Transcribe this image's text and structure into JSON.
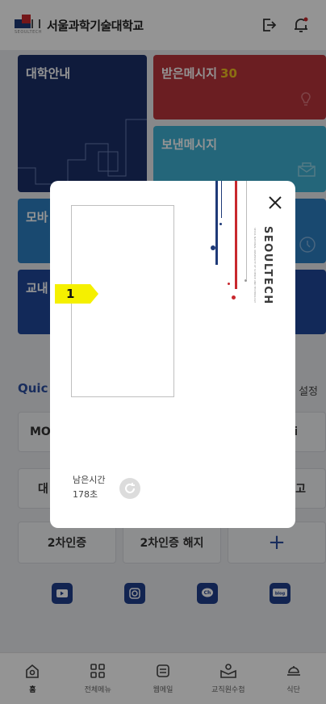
{
  "header": {
    "logo_sub": "SEOULTECH",
    "title": "서울과학기술대학교",
    "logout_icon": "logout-icon",
    "alarm_icon": "bell-settings-icon"
  },
  "tiles": {
    "university_info": "대학안내",
    "received_messages": "받은메시지",
    "received_count": "30",
    "sent_messages": "보낸메시지",
    "mobile_partial": "모바",
    "staff_partial": "교내"
  },
  "quick": {
    "title_partial": "Quic",
    "setting_partial": "설정",
    "row1_left_partial": "MO",
    "row1_right_partial": "i",
    "row2_left_partial": "대",
    "row2_right_partial": "고",
    "two_factor": "2차인증",
    "two_factor_release": "2차인증 해지",
    "add": "+"
  },
  "social": [
    "youtube-icon",
    "instagram-icon",
    "channel-icon",
    "blog-icon"
  ],
  "nav": [
    {
      "label": "홈",
      "icon": "home-icon"
    },
    {
      "label": "전체메뉴",
      "icon": "grid-menu-icon"
    },
    {
      "label": "웹메일",
      "icon": "webmail-icon"
    },
    {
      "label": "교직원수첩",
      "icon": "staff-notebook-icon"
    },
    {
      "label": "식단",
      "icon": "meal-icon"
    }
  ],
  "modal": {
    "brand": "SEOULTECH",
    "brand_sub": "SEOUL NATIONAL UNIVERSITY OF SCIENCE AND TECHNOLOGY",
    "remaining_label": "남은시간",
    "remaining_value": "178초",
    "close": "×"
  },
  "marker": {
    "number": "1"
  },
  "colors": {
    "navy": "#1b2f68",
    "red": "#b8343c",
    "sky": "#3fb0d3",
    "blue": "#2c7fc2",
    "accent": "#2c4fa0"
  }
}
